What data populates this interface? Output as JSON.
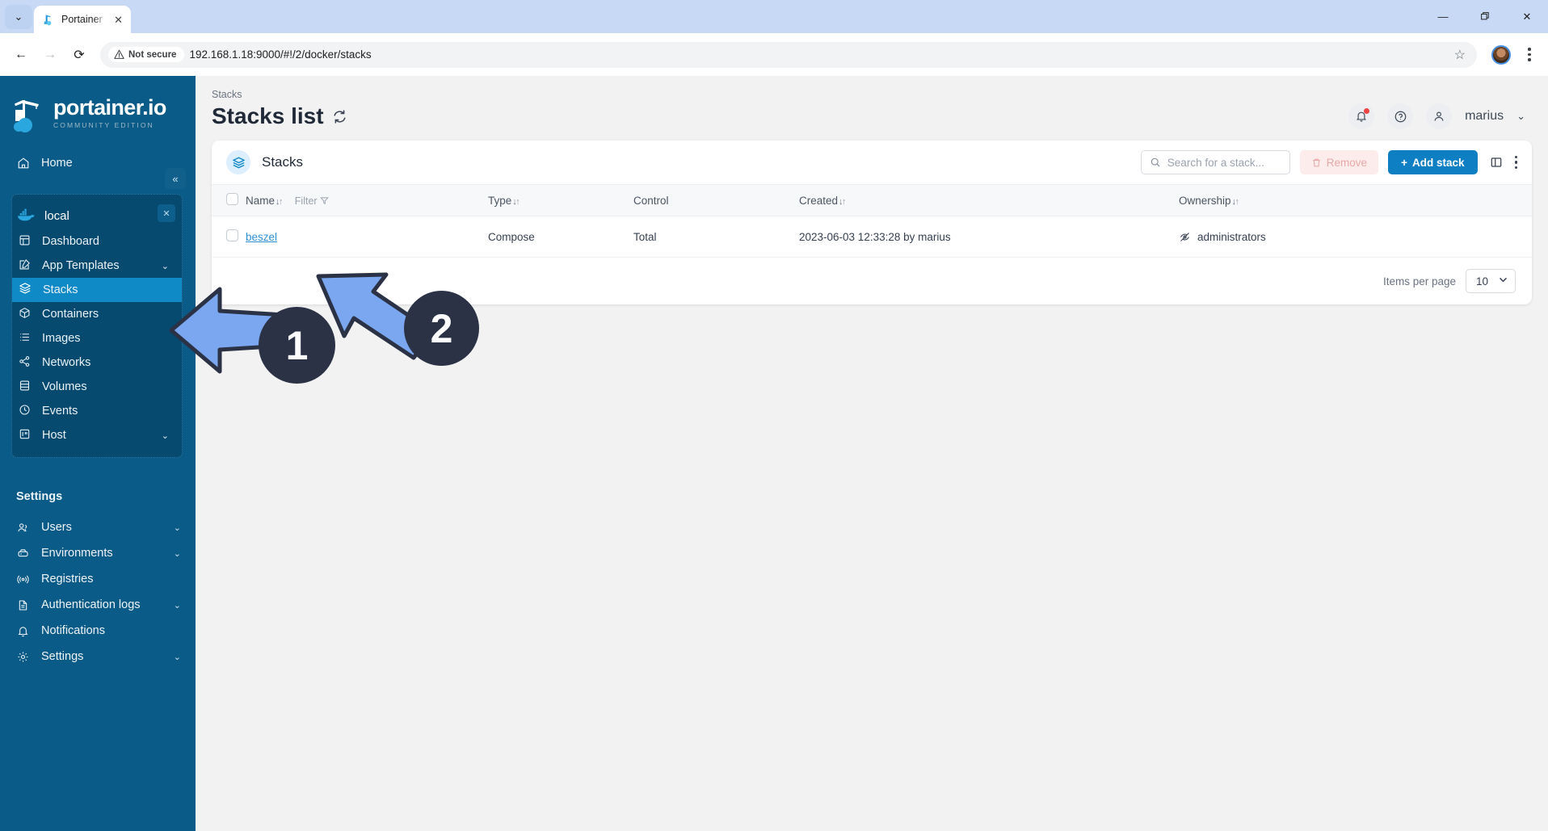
{
  "browser": {
    "tab": {
      "title": "Portainer",
      "favicon": "portainer-favicon",
      "close_label": "✕"
    },
    "tab_chevron": "⌄",
    "window_controls": {
      "minimize": "—",
      "maximize": "❐",
      "close": "✕"
    },
    "nav": {
      "back": "←",
      "forward": "→",
      "reload": "⟳"
    },
    "security": {
      "icon": "warning-triangle",
      "label": "Not secure"
    },
    "url": "192.168.1.18:9000/#!/2/docker/stacks",
    "bookmark_star": "☆"
  },
  "sidebar": {
    "logo": {
      "main": "portainer.io",
      "sub": "COMMUNITY EDITION"
    },
    "collapse": "«",
    "top_items": [
      {
        "label": "Home",
        "icon": "home-icon"
      }
    ],
    "environment": {
      "name": "local",
      "icon": "docker-icon",
      "close": "✕",
      "items": [
        {
          "label": "Dashboard",
          "icon": "dashboard-icon",
          "chevron": "",
          "active": false
        },
        {
          "label": "App Templates",
          "icon": "template-icon",
          "chevron": "⌄",
          "active": false
        },
        {
          "label": "Stacks",
          "icon": "stacks-icon",
          "chevron": "",
          "active": true
        },
        {
          "label": "Containers",
          "icon": "containers-icon",
          "chevron": "",
          "active": false
        },
        {
          "label": "Images",
          "icon": "images-icon",
          "chevron": "",
          "active": false
        },
        {
          "label": "Networks",
          "icon": "networks-icon",
          "chevron": "",
          "active": false
        },
        {
          "label": "Volumes",
          "icon": "volumes-icon",
          "chevron": "",
          "active": false
        },
        {
          "label": "Events",
          "icon": "events-icon",
          "chevron": "",
          "active": false
        },
        {
          "label": "Host",
          "icon": "host-icon",
          "chevron": "⌄",
          "active": false
        }
      ]
    },
    "settings_heading": "Settings",
    "settings_items": [
      {
        "label": "Users",
        "icon": "users-icon",
        "chevron": "⌄"
      },
      {
        "label": "Environments",
        "icon": "environments-icon",
        "chevron": "⌄"
      },
      {
        "label": "Registries",
        "icon": "registries-icon",
        "chevron": ""
      },
      {
        "label": "Authentication logs",
        "icon": "auth-logs-icon",
        "chevron": "⌄"
      },
      {
        "label": "Notifications",
        "icon": "notifications-icon",
        "chevron": ""
      },
      {
        "label": "Settings",
        "icon": "settings-gear-icon",
        "chevron": "⌄"
      }
    ]
  },
  "header": {
    "breadcrumb": "Stacks",
    "title": "Stacks list",
    "refresh_icon": "refresh-icon",
    "notification_icon": "bell-icon",
    "help_icon": "help-icon",
    "user_icon": "user-icon",
    "user_name": "marius",
    "user_chevron": "⌄"
  },
  "card": {
    "icon": "stacks-icon",
    "title": "Stacks",
    "search": {
      "placeholder": "Search for a stack...",
      "value": "",
      "icon": "search-icon"
    },
    "remove_label": "Remove",
    "remove_icon": "trash-icon",
    "add_label": "Add stack",
    "add_prefix": "+",
    "columns_icon": "columns-icon",
    "more_icon": "kebab-icon"
  },
  "table": {
    "columns": [
      {
        "label": "Name",
        "sortable": true,
        "filter": "Filter"
      },
      {
        "label": "Type",
        "sortable": true
      },
      {
        "label": "Control",
        "sortable": false
      },
      {
        "label": "Created",
        "sortable": true
      },
      {
        "label": "Ownership",
        "sortable": true
      }
    ],
    "rows": [
      {
        "name": "beszel",
        "type": "Compose",
        "control": "Total",
        "created": "2023-06-03 12:33:28 by marius",
        "ownership": "administrators",
        "ownership_icon": "eye-off-icon"
      }
    ]
  },
  "footer": {
    "items_per_page_label": "Items per page",
    "items_per_page_value": "10",
    "chevron": "⌄"
  },
  "annotations": [
    {
      "number": "1",
      "target": "sidebar-stacks-item"
    },
    {
      "number": "2",
      "target": "stack-name-link"
    }
  ],
  "colors": {
    "sidebar": "#0a5b87",
    "sidebar_group": "#064a70",
    "active_item": "#0f8ac7",
    "accent": "#0f7fc4",
    "link": "#2f8fd6",
    "annotation_arrow": "#7aa7f0",
    "annotation_badge": "#2b3245",
    "danger": "#fdecec"
  }
}
